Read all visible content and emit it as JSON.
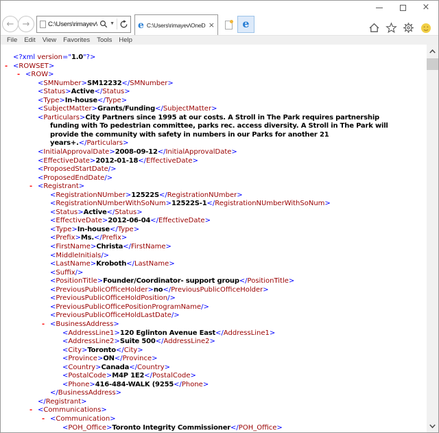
{
  "window": {
    "controls": [
      {
        "name": "minimize-button"
      },
      {
        "name": "maximize-button"
      },
      {
        "name": "close-button",
        "glyph": "×"
      }
    ]
  },
  "browser": {
    "address": "C:\\Users\\rimayev\\OneDriv",
    "address_icons": [
      "page-icon",
      "search-icon",
      "dropdown-caret",
      "refresh-icon"
    ],
    "nav": {
      "back": "←",
      "forward": "→"
    },
    "tab": {
      "title": "C:\\Users\\rimayev\\OneDrive...",
      "close_glyph": "×",
      "favicon": "ie-logo-icon"
    },
    "toolbar_icons": [
      "new-tab-icon",
      "ie-logo-button",
      "home-icon",
      "star-icon",
      "gear-icon",
      "smiley-icon"
    ],
    "menu": [
      "File",
      "Edit",
      "View",
      "Favorites",
      "Tools",
      "Help"
    ]
  },
  "colors": {
    "xml_markup": "#0000ff",
    "xml_tag": "#990000",
    "xml_toggle": "#ff0000",
    "xml_value": "#000000",
    "ie_blue": "#2a7fd4",
    "smiley_yellow": "#f2cf45",
    "menubar_bg": "#f0f0f0",
    "scrollbar_bg": "#f1f1f1"
  },
  "xml": {
    "syntax": {
      "lt": "<",
      "gt": ">",
      "lt_slash": "</",
      "slash_gt": "/>",
      "collapse": "-"
    },
    "declaration": {
      "markup_open": "<?xml ",
      "attr_name": "version",
      "markup_eq": "=\"",
      "attr_value": "1.0",
      "markup_close": "\"?>"
    },
    "lines": [
      {
        "t": "start",
        "i": 0,
        "n": "ROWSET"
      },
      {
        "t": "start",
        "i": 1,
        "n": "ROW"
      },
      {
        "t": "elem",
        "i": 2,
        "n": "SMNumber",
        "v": "SM12232"
      },
      {
        "t": "elem",
        "i": 2,
        "n": "Status",
        "v": "Active"
      },
      {
        "t": "elem",
        "i": 2,
        "n": "Type",
        "v": "In-house"
      },
      {
        "t": "elem",
        "i": 2,
        "n": "SubjectMatter",
        "v": "Grants/Funding"
      },
      {
        "t": "wrapelem",
        "i": 2,
        "n": "Particulars",
        "segs": [
          "City Partners since 1995 at our costs. A Stroll in The Park requires partnership",
          "funding with To pedestrian committee, parks rec. access diversity. A Stroll in The Park will",
          "provide the community with safety in numbers in our Parks for another 21",
          "years+."
        ]
      },
      {
        "t": "elem",
        "i": 2,
        "n": "InitialApprovalDate",
        "v": "2008-09-12"
      },
      {
        "t": "elem",
        "i": 2,
        "n": "EffectiveDate",
        "v": "2012-01-18"
      },
      {
        "t": "empty",
        "i": 2,
        "n": "ProposedStartDate"
      },
      {
        "t": "empty",
        "i": 2,
        "n": "ProposedEndDate"
      },
      {
        "t": "start",
        "i": 2,
        "n": "Registrant"
      },
      {
        "t": "elem",
        "i": 3,
        "n": "RegistrationNUmber",
        "v": "12522S"
      },
      {
        "t": "elem",
        "i": 3,
        "n": "RegistrationNUmberWithSoNum",
        "v": "12522S-1"
      },
      {
        "t": "elem",
        "i": 3,
        "n": "Status",
        "v": "Active"
      },
      {
        "t": "elem",
        "i": 3,
        "n": "EffectiveDate",
        "v": "2012-06-04"
      },
      {
        "t": "elem",
        "i": 3,
        "n": "Type",
        "v": "In-house"
      },
      {
        "t": "elem",
        "i": 3,
        "n": "Prefix",
        "v": "Ms."
      },
      {
        "t": "elem",
        "i": 3,
        "n": "FirstName",
        "v": "Christa"
      },
      {
        "t": "empty",
        "i": 3,
        "n": "MiddleInitials"
      },
      {
        "t": "elem",
        "i": 3,
        "n": "LastName",
        "v": "Kroboth"
      },
      {
        "t": "empty",
        "i": 3,
        "n": "Suffix"
      },
      {
        "t": "elem",
        "i": 3,
        "n": "PositionTitle",
        "v": "Founder/Coordinator- support group"
      },
      {
        "t": "elem",
        "i": 3,
        "n": "PreviousPublicOfficeHolder",
        "v": "no"
      },
      {
        "t": "empty",
        "i": 3,
        "n": "PreviousPublicOfficeHoldPosition"
      },
      {
        "t": "empty",
        "i": 3,
        "n": "PreviousPublicOfficePositionProgramName"
      },
      {
        "t": "empty",
        "i": 3,
        "n": "PreviousPublicOfficeHoldLastDate"
      },
      {
        "t": "start",
        "i": 3,
        "n": "BusinessAddress"
      },
      {
        "t": "elem",
        "i": 4,
        "n": "AddressLine1",
        "v": "120 Eglinton Avenue East"
      },
      {
        "t": "elem",
        "i": 4,
        "n": "AddressLine2",
        "v": "Suite 500"
      },
      {
        "t": "elem",
        "i": 4,
        "n": "City",
        "v": "Toronto"
      },
      {
        "t": "elem",
        "i": 4,
        "n": "Province",
        "v": "ON"
      },
      {
        "t": "elem",
        "i": 4,
        "n": "Country",
        "v": "Canada"
      },
      {
        "t": "elem",
        "i": 4,
        "n": "PostalCode",
        "v": "M4P 1E2"
      },
      {
        "t": "elem",
        "i": 4,
        "n": "Phone",
        "v": "416-484-WALK (9255"
      },
      {
        "t": "end",
        "i": 3,
        "n": "BusinessAddress"
      },
      {
        "t": "end",
        "i": 2,
        "n": "Registrant"
      },
      {
        "t": "start",
        "i": 2,
        "n": "Communications"
      },
      {
        "t": "start",
        "i": 3,
        "n": "Communication"
      },
      {
        "t": "elem",
        "i": 4,
        "n": "POH_Office",
        "v": "Toronto Integrity Commissioner"
      }
    ]
  }
}
